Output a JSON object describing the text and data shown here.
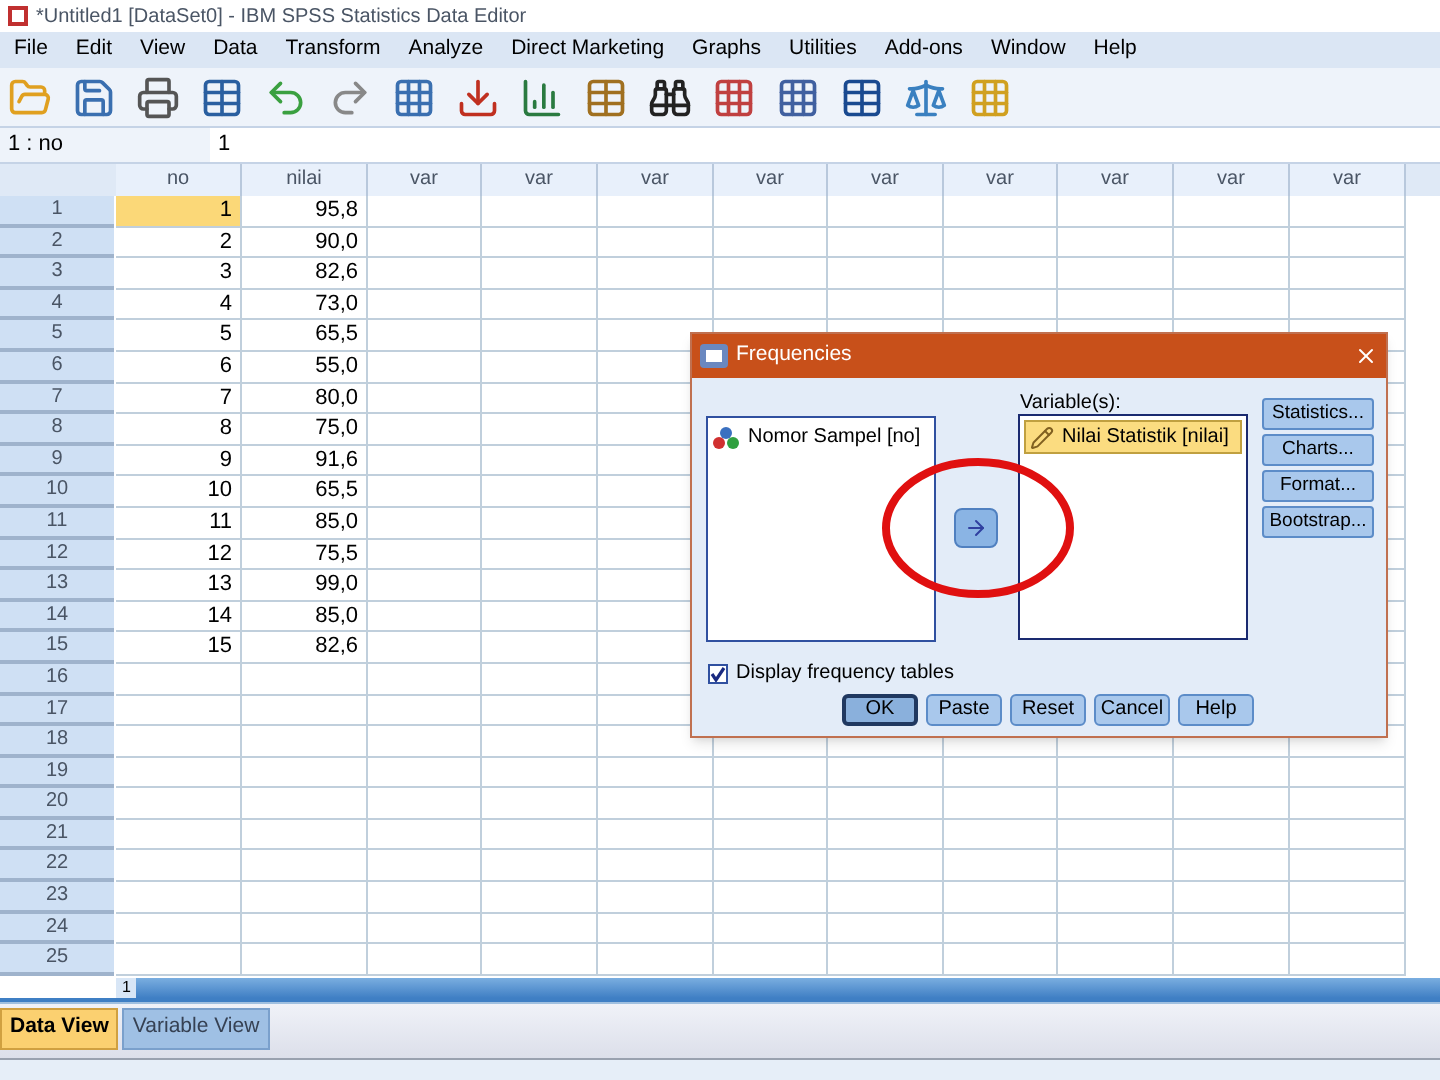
{
  "window": {
    "title": "*Untitled1 [DataSet0] - IBM SPSS Statistics Data Editor"
  },
  "menu": [
    "File",
    "Edit",
    "View",
    "Data",
    "Transform",
    "Analyze",
    "Direct Marketing",
    "Graphs",
    "Utilities",
    "Add-ons",
    "Window",
    "Help"
  ],
  "cell_editor": {
    "reference": "1 : no",
    "value": "1"
  },
  "grid": {
    "columns": [
      "no",
      "nilai",
      "var",
      "var",
      "var",
      "var",
      "var",
      "var",
      "var",
      "var",
      "var"
    ],
    "rows": [
      {
        "number": "1",
        "cells": [
          {
            "text": "1",
            "selected": true
          },
          {
            "text": "95,8",
            "selected": false
          }
        ]
      },
      {
        "number": "2",
        "cells": [
          {
            "text": "2",
            "selected": false
          },
          {
            "text": "90,0",
            "selected": false
          }
        ]
      },
      {
        "number": "3",
        "cells": [
          {
            "text": "3",
            "selected": false
          },
          {
            "text": "82,6",
            "selected": false
          }
        ]
      },
      {
        "number": "4",
        "cells": [
          {
            "text": "4",
            "selected": false
          },
          {
            "text": "73,0",
            "selected": false
          }
        ]
      },
      {
        "number": "5",
        "cells": [
          {
            "text": "5",
            "selected": false
          },
          {
            "text": "65,5",
            "selected": false
          }
        ]
      },
      {
        "number": "6",
        "cells": [
          {
            "text": "6",
            "selected": false
          },
          {
            "text": "55,0",
            "selected": false
          }
        ]
      },
      {
        "number": "7",
        "cells": [
          {
            "text": "7",
            "selected": false
          },
          {
            "text": "80,0",
            "selected": false
          }
        ]
      },
      {
        "number": "8",
        "cells": [
          {
            "text": "8",
            "selected": false
          },
          {
            "text": "75,0",
            "selected": false
          }
        ]
      },
      {
        "number": "9",
        "cells": [
          {
            "text": "9",
            "selected": false
          },
          {
            "text": "91,6",
            "selected": false
          }
        ]
      },
      {
        "number": "10",
        "cells": [
          {
            "text": "10",
            "selected": false
          },
          {
            "text": "65,5",
            "selected": false
          }
        ]
      },
      {
        "number": "11",
        "cells": [
          {
            "text": "11",
            "selected": false
          },
          {
            "text": "85,0",
            "selected": false
          }
        ]
      },
      {
        "number": "12",
        "cells": [
          {
            "text": "12",
            "selected": false
          },
          {
            "text": "75,5",
            "selected": false
          }
        ]
      },
      {
        "number": "13",
        "cells": [
          {
            "text": "13",
            "selected": false
          },
          {
            "text": "99,0",
            "selected": false
          }
        ]
      },
      {
        "number": "14",
        "cells": [
          {
            "text": "14",
            "selected": false
          },
          {
            "text": "85,0",
            "selected": false
          }
        ]
      },
      {
        "number": "15",
        "cells": [
          {
            "text": "15",
            "selected": false
          },
          {
            "text": "82,6",
            "selected": false
          }
        ]
      },
      {
        "number": "16",
        "cells": []
      },
      {
        "number": "17",
        "cells": []
      },
      {
        "number": "18",
        "cells": []
      },
      {
        "number": "19",
        "cells": []
      },
      {
        "number": "20",
        "cells": []
      },
      {
        "number": "21",
        "cells": []
      },
      {
        "number": "22",
        "cells": []
      },
      {
        "number": "23",
        "cells": []
      },
      {
        "number": "24",
        "cells": []
      },
      {
        "number": "25",
        "cells": []
      }
    ],
    "scroll_label": "1"
  },
  "dialog": {
    "title": "Frequencies",
    "source_items": [
      {
        "label": "Nomor Sampel [no]",
        "kind": "nominal"
      }
    ],
    "target_label": "Variable(s):",
    "target_items": [
      {
        "label": "Nilai Statistik [nilai]",
        "kind": "scale",
        "selected": true
      }
    ],
    "side_buttons": [
      "Statistics...",
      "Charts...",
      "Format...",
      "Bootstrap..."
    ],
    "checkbox": {
      "label": "Display frequency tables",
      "checked": true
    },
    "buttons": [
      {
        "label": "OK",
        "default": true
      },
      {
        "label": "Paste",
        "default": false
      },
      {
        "label": "Reset",
        "default": false
      },
      {
        "label": "Cancel",
        "default": false
      },
      {
        "label": "Help",
        "default": false
      }
    ]
  },
  "tabs": [
    {
      "label": "Data View",
      "selected": true
    },
    {
      "label": "Variable View",
      "selected": false
    }
  ]
}
